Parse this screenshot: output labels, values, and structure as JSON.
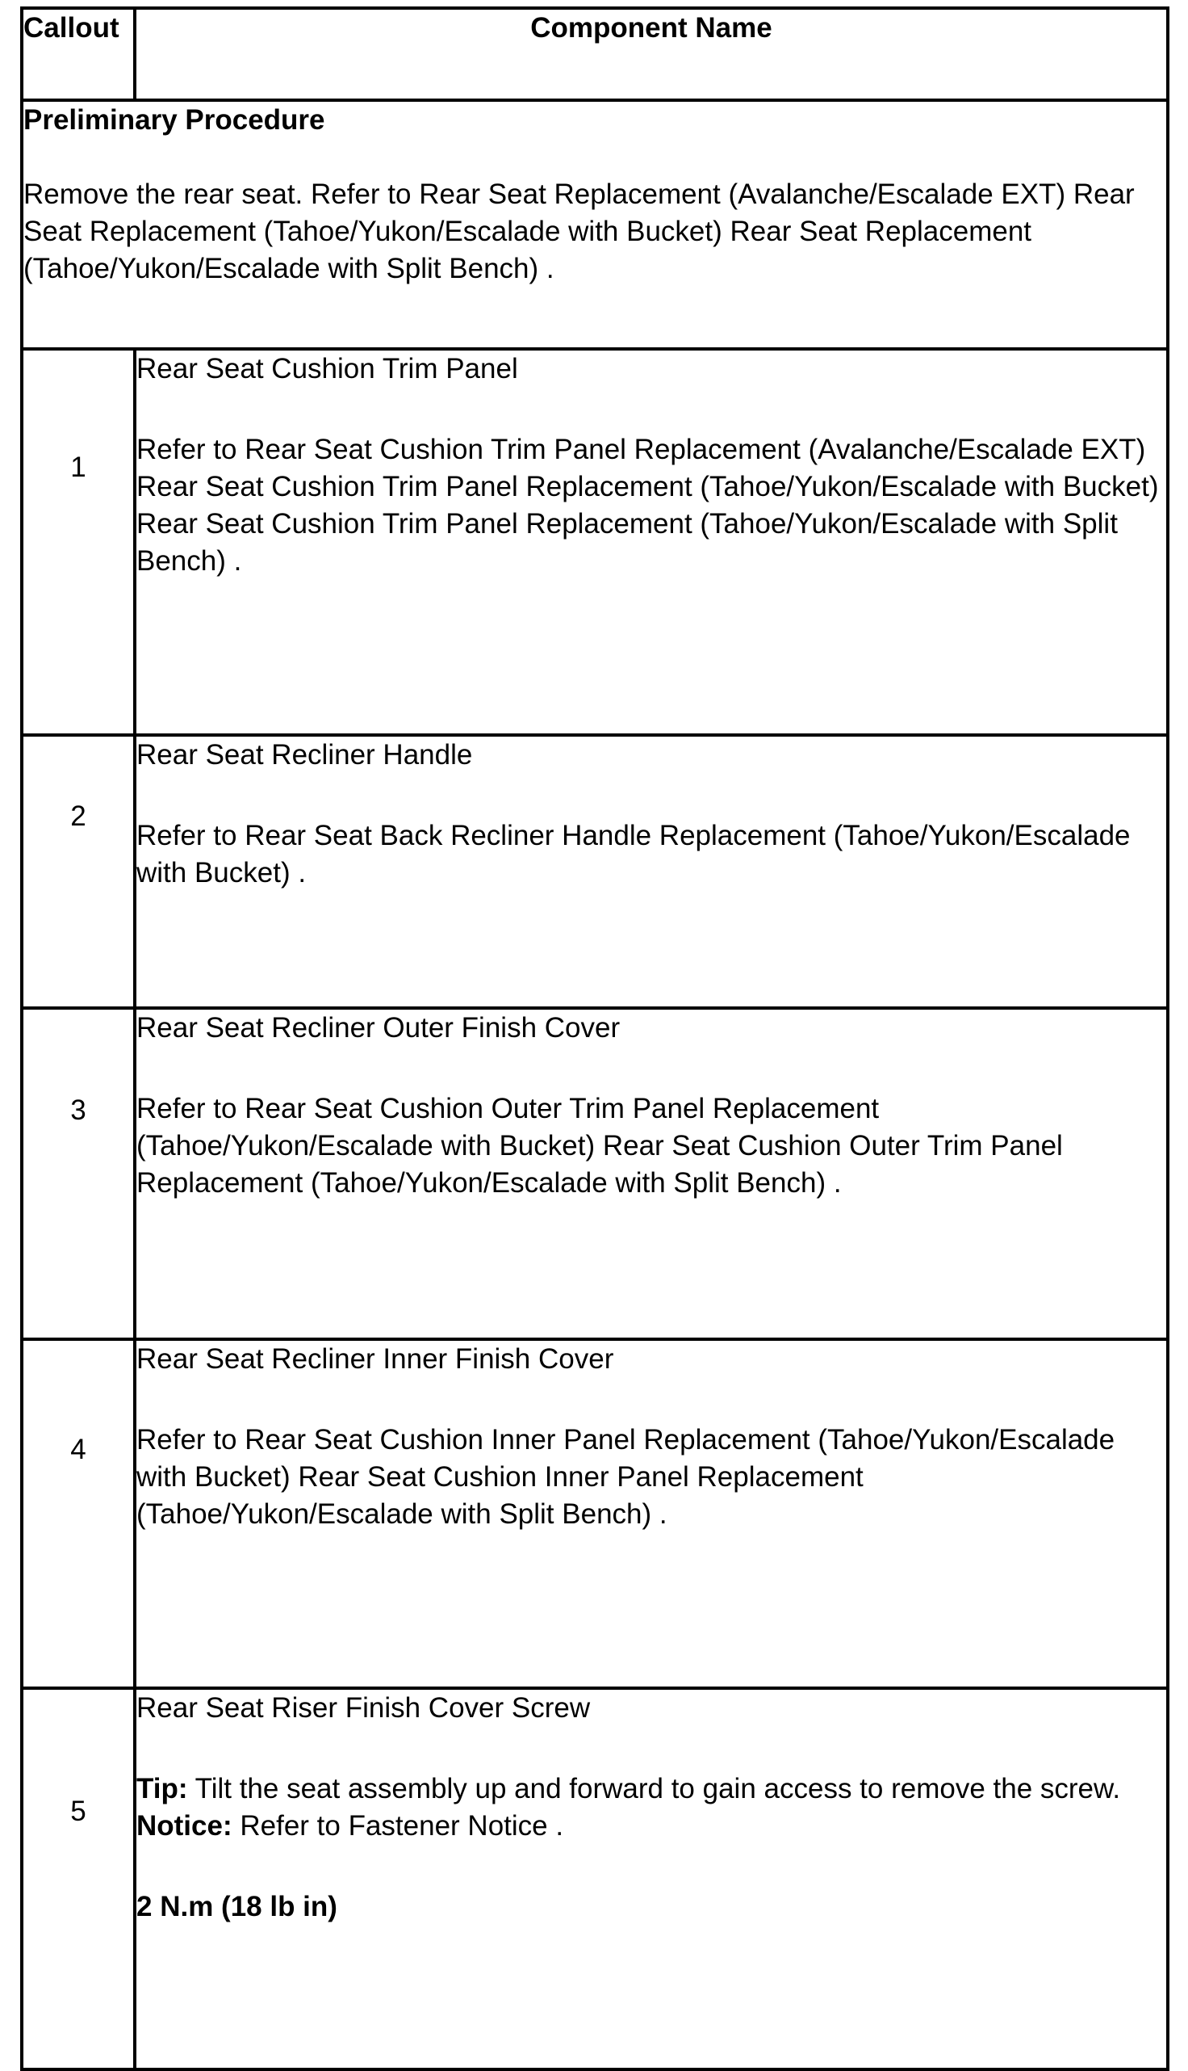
{
  "header": {
    "callout": "Callout",
    "component_name": "Component Name"
  },
  "preliminary": {
    "title": "Preliminary Procedure",
    "text": "Remove the rear seat. Refer to Rear Seat Replacement (Avalanche/Escalade EXT) Rear Seat Replacement (Tahoe/Yukon/Escalade with Bucket) Rear Seat Replacement (Tahoe/Yukon/Escalade with Split Bench) ."
  },
  "rows": [
    {
      "callout": "1",
      "name": "Rear Seat Cushion Trim Panel",
      "ref": "Refer to Rear Seat Cushion Trim Panel Replacement (Avalanche/Escalade EXT) Rear Seat Cushion Trim Panel Replacement (Tahoe/Yukon/Escalade with Bucket) Rear Seat Cushion Trim Panel Replacement (Tahoe/Yukon/Escalade with Split Bench) ."
    },
    {
      "callout": "2",
      "name": "Rear Seat Recliner Handle",
      "ref": "Refer to Rear Seat Back Recliner Handle Replacement (Tahoe/Yukon/Escalade with Bucket) ."
    },
    {
      "callout": "3",
      "name": "Rear Seat Recliner Outer Finish Cover",
      "ref": "Refer to Rear Seat Cushion Outer Trim Panel Replacement (Tahoe/Yukon/Escalade with Bucket) Rear Seat Cushion Outer Trim Panel Replacement (Tahoe/Yukon/Escalade with Split Bench) ."
    },
    {
      "callout": "4",
      "name": "Rear Seat Recliner Inner Finish Cover",
      "ref": "Refer to Rear Seat Cushion Inner Panel Replacement (Tahoe/Yukon/Escalade with Bucket) Rear Seat Cushion Inner Panel Replacement (Tahoe/Yukon/Escalade with Split Bench) ."
    },
    {
      "callout": "5",
      "name": "Rear Seat Riser Finish Cover Screw",
      "tip_label": "Tip:",
      "tip_text": "Tilt the seat assembly up and forward to gain access to remove the screw.",
      "notice_label": "Notice:",
      "notice_text": "Refer to Fastener Notice .",
      "torque": "2 N.m (18 lb in)"
    }
  ]
}
